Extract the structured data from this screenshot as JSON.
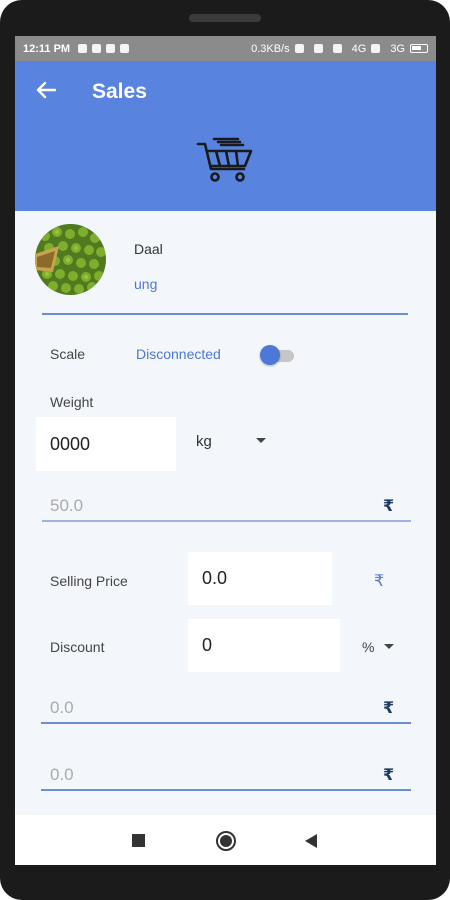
{
  "status_bar": {
    "time": "12:11 PM",
    "speed": "0.3KB/s",
    "network_1": "4G",
    "network_2": "3G"
  },
  "app_bar": {
    "title": "Sales",
    "back_icon": "arrow-left-icon",
    "header_icon": "shopping-cart-icon",
    "background_color": "#5884e0"
  },
  "product": {
    "name": "Daal",
    "subtitle": "ung",
    "image_icon": "green-lentils-image"
  },
  "scale": {
    "label": "Scale",
    "status": "Disconnected",
    "toggle_on": true
  },
  "weight": {
    "label": "Weight",
    "value": "0000",
    "unit": "kg"
  },
  "price_per_unit": {
    "value": "50.0",
    "currency": "₹"
  },
  "selling_price": {
    "label": "Selling Price",
    "value": "0.0",
    "currency": "₹"
  },
  "discount": {
    "label": "Discount",
    "value": "0",
    "unit": "%"
  },
  "discount_amount": {
    "placeholder": "0.0",
    "currency": "₹"
  },
  "total_amount": {
    "placeholder": "0.0",
    "currency": "₹"
  },
  "nav_bar": {
    "recent_icon": "square-icon",
    "home_icon": "circle-icon",
    "back_icon": "triangle-left-icon"
  },
  "colors": {
    "accent": "#4d78d6",
    "screen_bg": "#f3f7fc"
  }
}
